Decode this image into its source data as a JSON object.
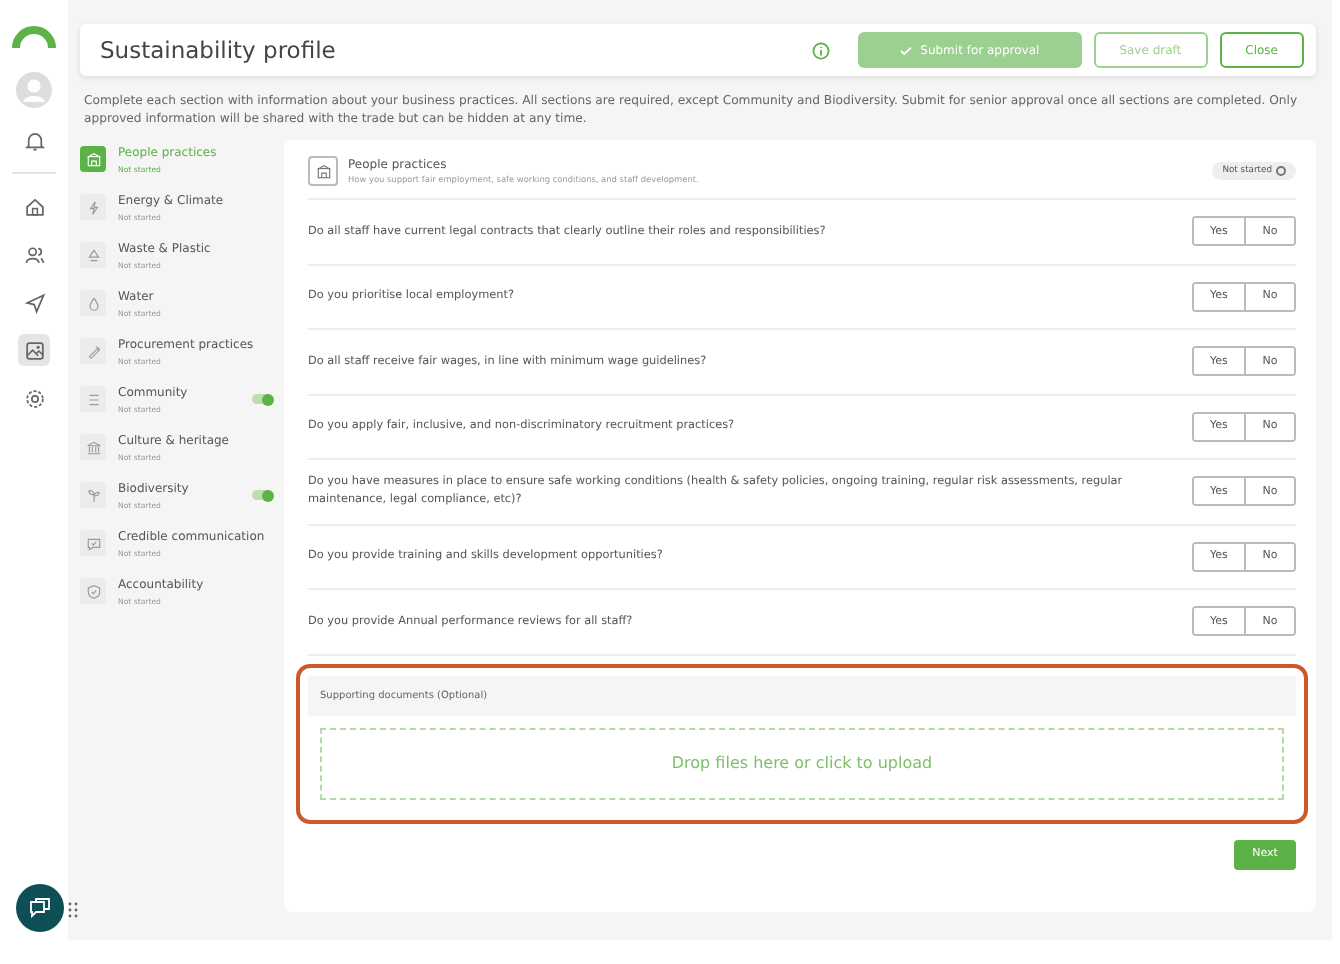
{
  "header": {
    "title": "Sustainability profile",
    "buttons": [
      {
        "label": "Submit for approval",
        "kind": "primary",
        "disabled": true
      },
      {
        "label": "Save draft",
        "kind": "outline",
        "disabled": true
      },
      {
        "label": "Close",
        "kind": "outline",
        "disabled": false
      }
    ]
  },
  "rail": {
    "items": [
      {
        "selected": false
      },
      {
        "selected": false
      },
      {
        "selected": false
      },
      {
        "selected": true
      },
      {
        "selected": false
      }
    ]
  },
  "intro": "Complete each section with information about your business practices. All sections are required, except Community and Biodiversity. Submit for senior approval once all sections are completed. Only approved information will be shared with the trade but can be hidden at any time.",
  "sections": [
    {
      "label": "People practices",
      "status": "Not started",
      "selected": true,
      "kind": "plain"
    },
    {
      "label": "Energy & Climate",
      "status": "Not started",
      "selected": false,
      "kind": "plain"
    },
    {
      "label": "Waste & Plastic",
      "status": "Not started",
      "selected": false,
      "kind": "plain"
    },
    {
      "label": "Water",
      "status": "Not started",
      "selected": false,
      "kind": "plain"
    },
    {
      "label": "Procurement practices",
      "status": "Not started",
      "selected": false,
      "kind": "plain"
    },
    {
      "label": "Community",
      "status": "Not started",
      "selected": false,
      "kind": "toggle",
      "on": true
    },
    {
      "label": "Culture & heritage",
      "status": "Not started",
      "selected": false,
      "kind": "plain"
    },
    {
      "label": "Biodiversity",
      "status": "Not started",
      "selected": false,
      "kind": "toggle",
      "on": true
    },
    {
      "label": "Credible communication",
      "status": "Not started",
      "selected": false,
      "kind": "plain"
    },
    {
      "label": "Accountability",
      "status": "Not started",
      "selected": false,
      "kind": "plain"
    }
  ],
  "panel": {
    "title": "People practices",
    "subtitle": "How you support fair employment, safe working conditions, and staff development.",
    "status": "Not started",
    "questions": [
      {
        "text": "Do all staff have current legal contracts that clearly outline their roles and responsibilities?",
        "yes": "Yes",
        "no": "No"
      },
      {
        "text": "Do you prioritise local employment?",
        "yes": "Yes",
        "no": "No"
      },
      {
        "text": "Do all staff receive fair wages, in line with minimum wage guidelines?",
        "yes": "Yes",
        "no": "No"
      },
      {
        "text": "Do you apply fair, inclusive, and non-discriminatory recruitment practices?",
        "yes": "Yes",
        "no": "No"
      },
      {
        "text": "Do you have measures in place to ensure safe working conditions (health & safety policies, ongoing training, regular risk assessments, regular maintenance, legal compliance, etc)?",
        "yes": "Yes",
        "no": "No"
      },
      {
        "text": "Do you provide training and skills development opportunities?",
        "yes": "Yes",
        "no": "No"
      },
      {
        "text": "Do you provide Annual performance reviews for all staff?",
        "yes": "Yes",
        "no": "No"
      }
    ],
    "documents": {
      "title": "Supporting documents (Optional)",
      "dropzone": "Drop files here or click to upload",
      "highlighted": true
    },
    "next": "Next"
  }
}
